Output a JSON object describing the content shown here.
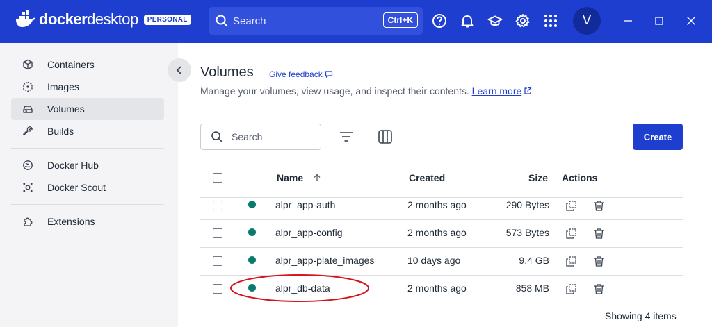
{
  "app": {
    "logo_brand": "docker",
    "logo_product": "desktop",
    "plan_badge": "PERSONAL",
    "search_placeholder": "Search",
    "search_shortcut": "Ctrl+K",
    "avatar_initial": "V",
    "header_icons": [
      "help-icon",
      "bell-icon",
      "learning-cap-icon",
      "gear-icon",
      "grid-apps-icon"
    ],
    "brand_color": "#1e3ecf"
  },
  "sidebar": {
    "items": [
      {
        "label": "Containers",
        "icon": "container-cube-icon"
      },
      {
        "label": "Images",
        "icon": "image-layers-icon"
      },
      {
        "label": "Volumes",
        "icon": "volume-drive-icon",
        "active": true
      },
      {
        "label": "Builds",
        "icon": "wrench-icon"
      },
      {
        "label": "Docker Hub",
        "icon": "hub-globe-icon"
      },
      {
        "label": "Docker Scout",
        "icon": "scout-icon"
      },
      {
        "label": "Extensions",
        "icon": "puzzle-icon"
      }
    ]
  },
  "page": {
    "title": "Volumes",
    "feedback_link": "Give feedback",
    "subtitle": "Manage your volumes, view usage, and inspect their contents.",
    "learn_more": "Learn more",
    "search_placeholder": "Search",
    "create_label": "Create"
  },
  "table": {
    "headers": {
      "name": "Name",
      "created": "Created",
      "size": "Size",
      "actions": "Actions"
    },
    "rows": [
      {
        "name": "alpr_app-auth",
        "created": "2 months ago",
        "size": "290 Bytes",
        "status": "in-use"
      },
      {
        "name": "alpr_app-config",
        "created": "2 months ago",
        "size": "573 Bytes",
        "status": "in-use"
      },
      {
        "name": "alpr_app-plate_images",
        "created": "10 days ago",
        "size": "9.4 GB",
        "status": "in-use"
      },
      {
        "name": "alpr_db-data",
        "created": "2 months ago",
        "size": "858 MB",
        "status": "in-use"
      }
    ],
    "footer": "Showing 4 items",
    "status_color": "#087b6c"
  }
}
